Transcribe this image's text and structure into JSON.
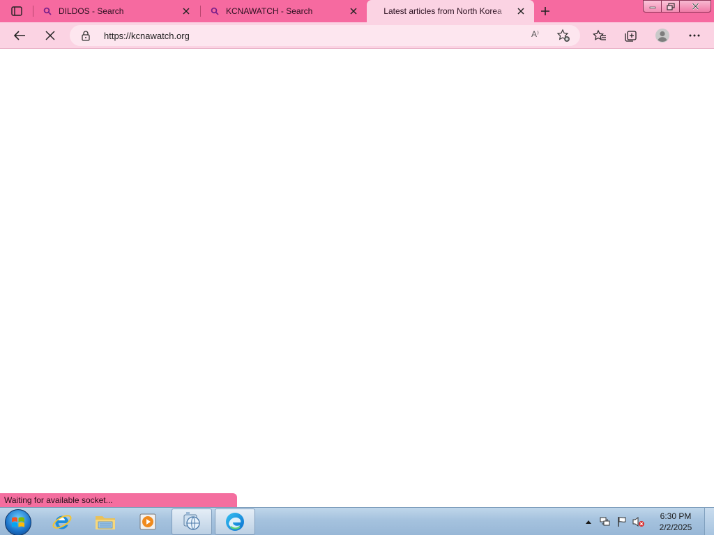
{
  "browser": {
    "tabs": [
      {
        "title": "DILDOS - Search",
        "favicon": "search-icon",
        "active": false
      },
      {
        "title": "KCNAWATCH - Search",
        "favicon": "search-icon",
        "active": false
      },
      {
        "title": "Latest articles from North Korea",
        "favicon": "",
        "active": true
      }
    ],
    "address": {
      "url": "https://kcnawatch.org"
    },
    "read_aloud_glyph": "A⁾"
  },
  "page": {
    "status_text": "Waiting for available socket..."
  },
  "taskbar": {
    "pinned": [
      "start-orb",
      "internet-explorer-icon",
      "file-explorer-icon",
      "media-player-icon",
      "network-app-icon",
      "edge-icon"
    ],
    "clock": {
      "time": "6:30 PM",
      "date": "2/2/2025"
    }
  },
  "colors": {
    "tabstrip": "#f66aa0",
    "active_tab": "#fbd3e3",
    "toolbar": "#fbd3e3",
    "status_bubble": "#f46e9f",
    "taskbar": "#a5c2de"
  }
}
